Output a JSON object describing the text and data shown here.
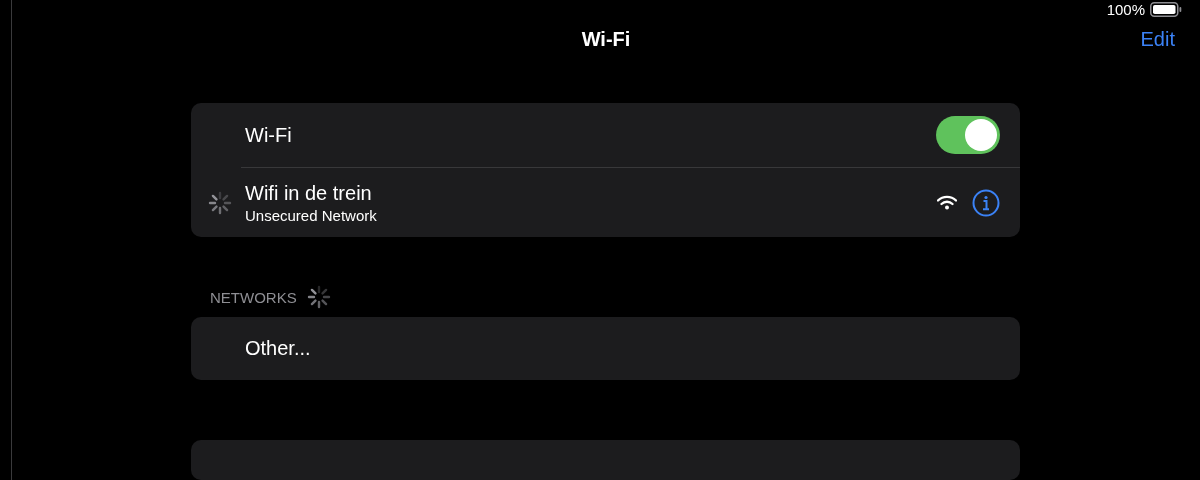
{
  "status_bar": {
    "battery_text": "100%"
  },
  "nav": {
    "title": "Wi-Fi",
    "edit": "Edit"
  },
  "wifi_toggle": {
    "label": "Wi-Fi",
    "on": true
  },
  "current_network": {
    "name": "Wifi in de trein",
    "status": "Unsecured Network",
    "connecting": true
  },
  "networks_section": {
    "header": "NETWORKS",
    "scanning": true,
    "items": [
      {
        "label": "Other..."
      }
    ]
  }
}
